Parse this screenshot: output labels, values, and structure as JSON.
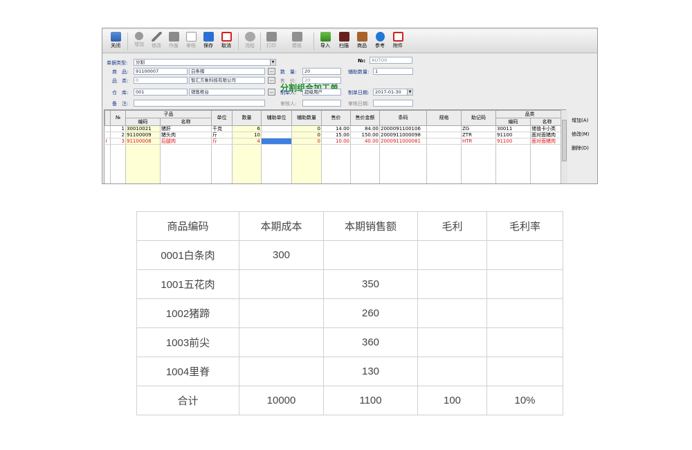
{
  "toolbar": {
    "buttons": [
      {
        "label": "关闭",
        "icon": "close-door-icon",
        "enabled": true
      },
      {
        "label": "增加",
        "icon": "add-icon",
        "enabled": false
      },
      {
        "label": "修改",
        "icon": "edit-icon",
        "enabled": false
      },
      {
        "label": "作废",
        "icon": "delete-icon",
        "enabled": false
      },
      {
        "label": "审核",
        "icon": "audit-icon",
        "enabled": false
      },
      {
        "label": "保存",
        "icon": "save-icon",
        "enabled": true
      },
      {
        "label": "取消",
        "icon": "cancel-icon",
        "enabled": true
      },
      {
        "label": "流程",
        "icon": "flow-icon",
        "enabled": false
      },
      {
        "label": "打印",
        "icon": "printer-icon",
        "enabled": false
      },
      {
        "label": "模板",
        "icon": "template-icon",
        "enabled": false
      },
      {
        "label": "导入",
        "icon": "import-icon",
        "enabled": true
      },
      {
        "label": "扫描",
        "icon": "scan-icon",
        "enabled": true
      },
      {
        "label": "商品",
        "icon": "goods-icon",
        "enabled": true
      },
      {
        "label": "参考",
        "icon": "info-icon",
        "enabled": true
      },
      {
        "label": "附件",
        "icon": "attachment-icon",
        "enabled": true
      }
    ]
  },
  "form": {
    "title": "分割组合加工单",
    "doc_type_label": "单据类型:",
    "doc_type_value": "分割",
    "no_label": "№:",
    "no_value": "AUTO0",
    "goods_label": "商　品:",
    "goods_code": "91100007",
    "goods_name": "白条猪",
    "qty_label": "数　量:",
    "qty_value": "20",
    "aux_qty_label": "辅助数量:",
    "aux_qty_value": "1",
    "category_label": "品　类:",
    "category_code": "0",
    "category_name": "智汇方象科技有限公司",
    "price_label": "售　价:",
    "price_value": "20",
    "warehouse_label": "仓　库:",
    "warehouse_code": "001",
    "warehouse_name": "销售柜台",
    "maker_label": "制单人:",
    "maker_value": "超级用户",
    "make_date_label": "制单日期:",
    "make_date_value": "2017-01-30",
    "remark_label": "备　注:",
    "remark_value": "",
    "auditor_label": "审核人:",
    "auditor_value": "",
    "audit_date_label": "审核日期:",
    "audit_date_value": "",
    "ellipsis": "..."
  },
  "grid": {
    "headers": {
      "no": "№",
      "child_group": "子品",
      "code": "编码",
      "name": "名称",
      "unit": "单位",
      "qty": "数量",
      "aux_unit": "辅助单位",
      "aux_qty": "辅助数量",
      "price": "售价",
      "amount": "售价金额",
      "barcode": "条码",
      "spec": "规格",
      "mnemonic": "助记码",
      "cat_group": "品类",
      "cat_code": "编码",
      "cat_name": "名称"
    },
    "rows": [
      {
        "marker": "",
        "no": "1",
        "code": "30010021",
        "name": "猪肝",
        "unit": "千克",
        "qty": "6",
        "aux_unit": "",
        "aux_qty": "0",
        "price": "14.00",
        "amount": "84.00",
        "barcode": "2000091100106",
        "spec": "",
        "mnemonic": "ZG",
        "cat_code": "30011",
        "cat_name": "储值卡小类",
        "red": false,
        "selected": false
      },
      {
        "marker": "",
        "no": "2",
        "code": "91100009",
        "name": "猪头肉",
        "unit": "斤",
        "qty": "10",
        "aux_unit": "",
        "aux_qty": "0",
        "price": "15.00",
        "amount": "150.00",
        "barcode": "2000911000098",
        "spec": "",
        "mnemonic": "ZTR",
        "cat_code": "91100",
        "cat_name": "面对面猪肉",
        "red": false,
        "selected": false
      },
      {
        "marker": "I",
        "no": "3",
        "code": "91100008",
        "name": "后腿肉",
        "unit": "斤",
        "qty": "4",
        "aux_unit": "",
        "aux_qty": "0",
        "price": "10.00",
        "amount": "40.00",
        "barcode": "2000911000081",
        "spec": "",
        "mnemonic": "HTR",
        "cat_code": "91100",
        "cat_name": "面对面猪肉",
        "red": true,
        "selected": true
      }
    ],
    "side_buttons": {
      "add": "增加(A)",
      "edit": "修改(M)",
      "delete": "删除(D)"
    }
  },
  "report": {
    "headers": [
      "商品编码",
      "本期成本",
      "本期销售额",
      "毛利",
      "毛利率"
    ],
    "rows": [
      [
        "0001白条肉",
        "300",
        "",
        "",
        ""
      ],
      [
        "1001五花肉",
        "",
        "350",
        "",
        ""
      ],
      [
        "1002猪蹄",
        "",
        "260",
        "",
        ""
      ],
      [
        "1003前尖",
        "",
        "360",
        "",
        ""
      ],
      [
        "1004里脊",
        "",
        "130",
        "",
        ""
      ],
      [
        "合计",
        "10000",
        "1100",
        "100",
        "10%"
      ]
    ]
  },
  "colors": {
    "title_green": "#1f8a2c",
    "label_blue": "#1a3c8c",
    "highlight_red": "#e01010",
    "selection_blue": "#3d7fe0",
    "qty_yellow": "#ffffd6"
  }
}
